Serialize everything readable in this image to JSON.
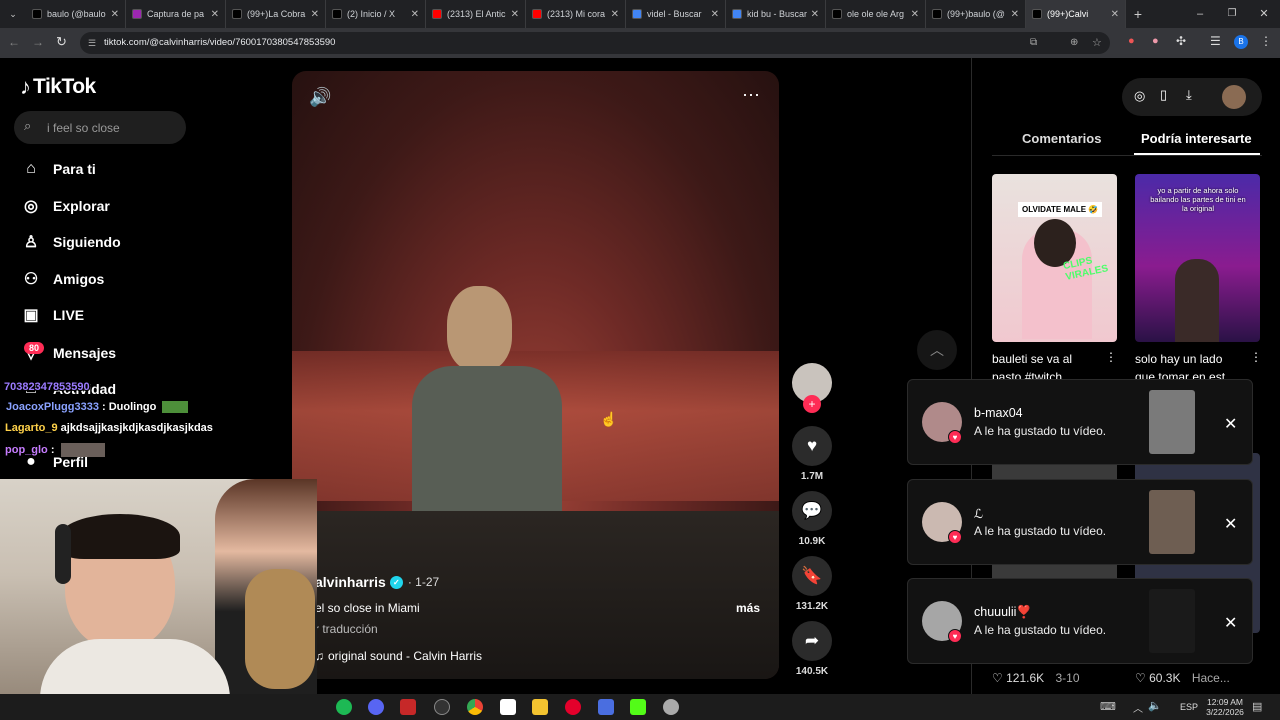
{
  "browser": {
    "tabs": [
      {
        "label": "baulo (@baulo",
        "color": "#000000",
        "active": false
      },
      {
        "label": "Captura de pa",
        "color": "#9c27b0",
        "active": false
      },
      {
        "label": "(99+)La Cobra",
        "color": "#000000",
        "active": false
      },
      {
        "label": "(2) Inicio / X",
        "color": "#000000",
        "active": false
      },
      {
        "label": "(2313) El Antic",
        "color": "#ff0000",
        "active": false
      },
      {
        "label": "(2313) Mi cora",
        "color": "#ff0000",
        "active": false
      },
      {
        "label": "videl - Buscar",
        "color": "#4285f4",
        "active": false
      },
      {
        "label": "kid bu - Buscar",
        "color": "#4285f4",
        "active": false
      },
      {
        "label": "ole ole ole Arg",
        "color": "#000000",
        "active": false
      },
      {
        "label": "(99+)baulo (@",
        "color": "#000000",
        "active": false
      },
      {
        "label": "(99+)Calvi",
        "color": "#000000",
        "active": true
      }
    ],
    "url": "tiktok.com/@calvinharris/video/7600170380547853590"
  },
  "tiktok": {
    "logo": "TikTok",
    "search_placeholder": "i feel so close",
    "nav": [
      {
        "label": "Para ti",
        "icon": "home-icon",
        "glyph": "⌂"
      },
      {
        "label": "Explorar",
        "icon": "compass-icon",
        "glyph": "◎"
      },
      {
        "label": "Siguiendo",
        "icon": "following-icon",
        "glyph": "♙"
      },
      {
        "label": "Amigos",
        "icon": "friends-icon",
        "glyph": "⚇"
      },
      {
        "label": "LIVE",
        "icon": "live-icon",
        "glyph": "▣"
      },
      {
        "label": "Mensajes",
        "icon": "messages-icon",
        "glyph": "▽"
      },
      {
        "label": "Actividad",
        "icon": "activity-icon",
        "glyph": "□"
      },
      {
        "label": "Perfil",
        "icon": "profile-icon",
        "glyph": "●"
      }
    ],
    "messages_badge": "80",
    "video": {
      "author": "alvinharris",
      "date": "· 1-27",
      "caption": "el so close in Miami",
      "more": "más",
      "translate": "r traducción",
      "sound": "original sound - Calvin Harris"
    },
    "actions": {
      "likes": "1.7M",
      "comments": "10.9K",
      "saves": "131.2K",
      "shares": "140.5K"
    },
    "right_panel": {
      "tab_comments": "Comentarios",
      "tab_interest": "Podría interesarte",
      "videos": [
        {
          "title": "bauleti se va al pasto #twitch",
          "overlay": "OLVIDATE MALE 🤣",
          "overlay2": "CLIPS VIRALES",
          "colorA": "#f1dede",
          "colorB": "#d7c7c4"
        },
        {
          "title": "solo hay un lado que tomar en est",
          "overlay": "yo a partir de ahora solo bailando las partes de tini en la original",
          "overlay2": "",
          "colorA": "#5a1f8a",
          "colorB": "#1c1b6b"
        }
      ],
      "bottom_stats": [
        {
          "likes": "121.6K",
          "date": "3-10"
        },
        {
          "likes": "60.3K",
          "date": "Hace..."
        }
      ]
    },
    "notifications": [
      {
        "name": "b-max04",
        "message": "A le ha gustado tu vídeo.",
        "avatar": "#b08a8a",
        "preview": "#7a7a7a"
      },
      {
        "name": "ℒ",
        "message": "A le ha gustado tu vídeo.",
        "avatar": "#cbb9b1",
        "preview": "#6e5e52"
      },
      {
        "name": "chuuulii❣️",
        "message": "A le ha gustado tu vídeo.",
        "avatar": "#a6a6a6",
        "preview": "#1a1a1a"
      }
    ]
  },
  "stream_overlay": {
    "chat": [
      {
        "text": "70382347853590",
        "color": "#9b7bff"
      },
      {
        "user": "JoacoxPlugg3333",
        "text": ": Duolingo",
        "color": "#8aa2ff"
      },
      {
        "user": "Lagarto_9",
        "text": "ajkdsajjkasjkdjkasdjkasjkdas",
        "color": "#ffd24a"
      },
      {
        "user": "pop_glo",
        "text": ":",
        "color": "#c77dff"
      }
    ]
  },
  "taskbar": {
    "time": "12:09 AM",
    "date": "3/22/2026",
    "lang": "ESP"
  }
}
